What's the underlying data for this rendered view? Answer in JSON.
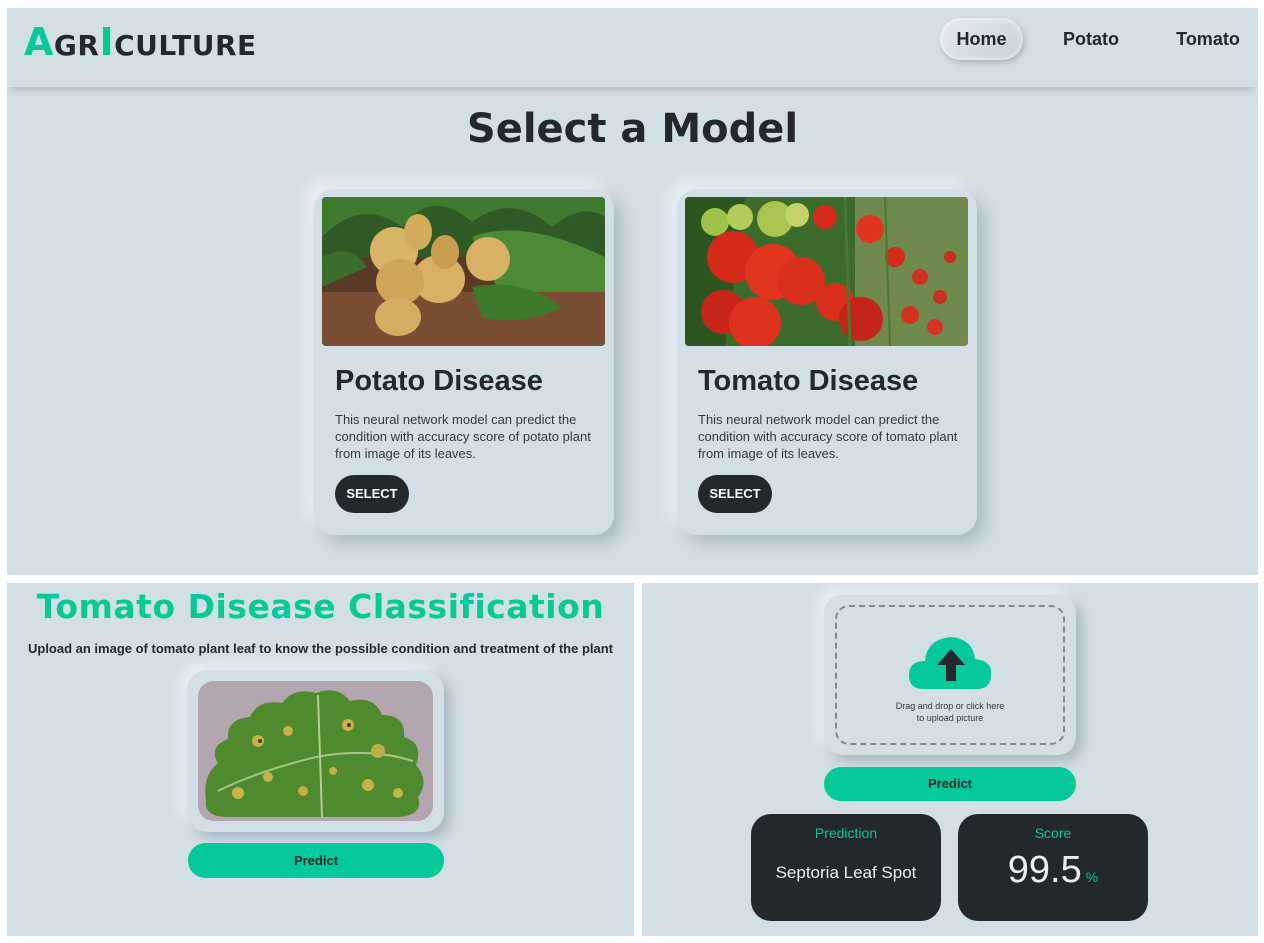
{
  "navbar": {
    "logo": {
      "cap1": "A",
      "small1": "GR",
      "cap2": "I",
      "small2": "CULTURE"
    },
    "items": [
      {
        "label": "Home"
      },
      {
        "label": "Potato"
      },
      {
        "label": "Tomato"
      }
    ]
  },
  "models": {
    "title": "Select a Model",
    "cards": [
      {
        "title": "Potato Disease",
        "description": "This neural network model can predict the condition with accuracy score of potato plant from image of its leaves.",
        "button": "SELECT"
      },
      {
        "title": "Tomato Disease",
        "description": "This neural network model can predict the condition with accuracy score of tomato plant from image of its leaves.",
        "button": "SELECT"
      }
    ]
  },
  "classification": {
    "title": "Tomato Disease Classification",
    "subtitle": "Upload an image of tomato plant leaf to know the possible condition and treatment of the plant",
    "predict_label": "Predict"
  },
  "upload": {
    "line1": "Drag and drop or click here",
    "line2": "to upload picture",
    "predict_label": "Predict"
  },
  "result": {
    "prediction_label": "Prediction",
    "prediction_value": "Septoria Leaf Spot",
    "score_label": "Score",
    "score_value": "99.5",
    "score_unit": "%"
  },
  "colors": {
    "background": "#d3dfe6",
    "accent": "#06c999",
    "dark": "#23282c"
  },
  "icons": [
    "cloud-upload-icon"
  ]
}
